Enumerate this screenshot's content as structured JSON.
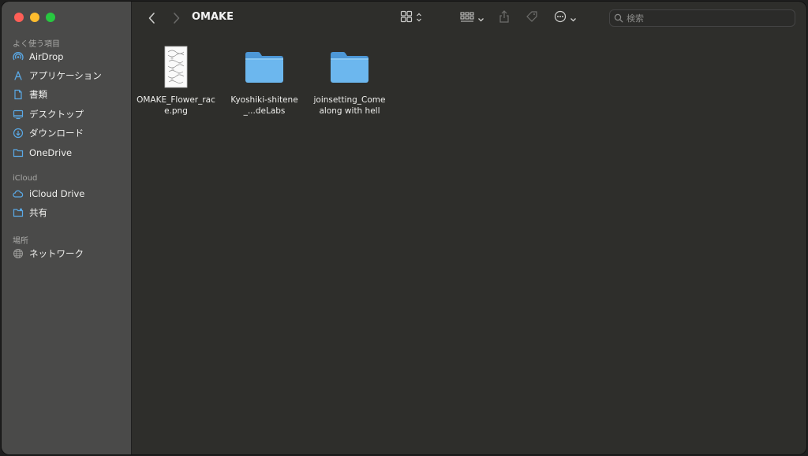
{
  "window": {
    "title": "OMAKE"
  },
  "sidebar": {
    "sections": [
      {
        "header": "よく使う項目",
        "items": [
          {
            "label": "AirDrop",
            "icon": "airdrop-icon"
          },
          {
            "label": "アプリケーション",
            "icon": "applications-icon"
          },
          {
            "label": "書類",
            "icon": "document-icon"
          },
          {
            "label": "デスクトップ",
            "icon": "desktop-icon"
          },
          {
            "label": "ダウンロード",
            "icon": "download-icon"
          },
          {
            "label": "OneDrive",
            "icon": "folder-icon"
          }
        ]
      },
      {
        "header": "iCloud",
        "items": [
          {
            "label": "iCloud Drive",
            "icon": "cloud-icon"
          },
          {
            "label": "共有",
            "icon": "shared-folder-icon"
          }
        ]
      },
      {
        "header": "場所",
        "items": [
          {
            "label": "ネットワーク",
            "icon": "network-icon"
          }
        ]
      }
    ]
  },
  "search": {
    "placeholder": "検索"
  },
  "files": [
    {
      "name": "OMAKE_Flower_race.png",
      "kind": "image"
    },
    {
      "name": "Kyoshiki-shitene_...deLabs",
      "kind": "folder"
    },
    {
      "name": "joinsetting_Come along with hell",
      "kind": "folder"
    }
  ],
  "colors": {
    "accent": "#5aa9e6",
    "folder": "#6cb7ee",
    "sidebar_bg": "#4a4a49",
    "content_bg": "#2e2e2b"
  }
}
